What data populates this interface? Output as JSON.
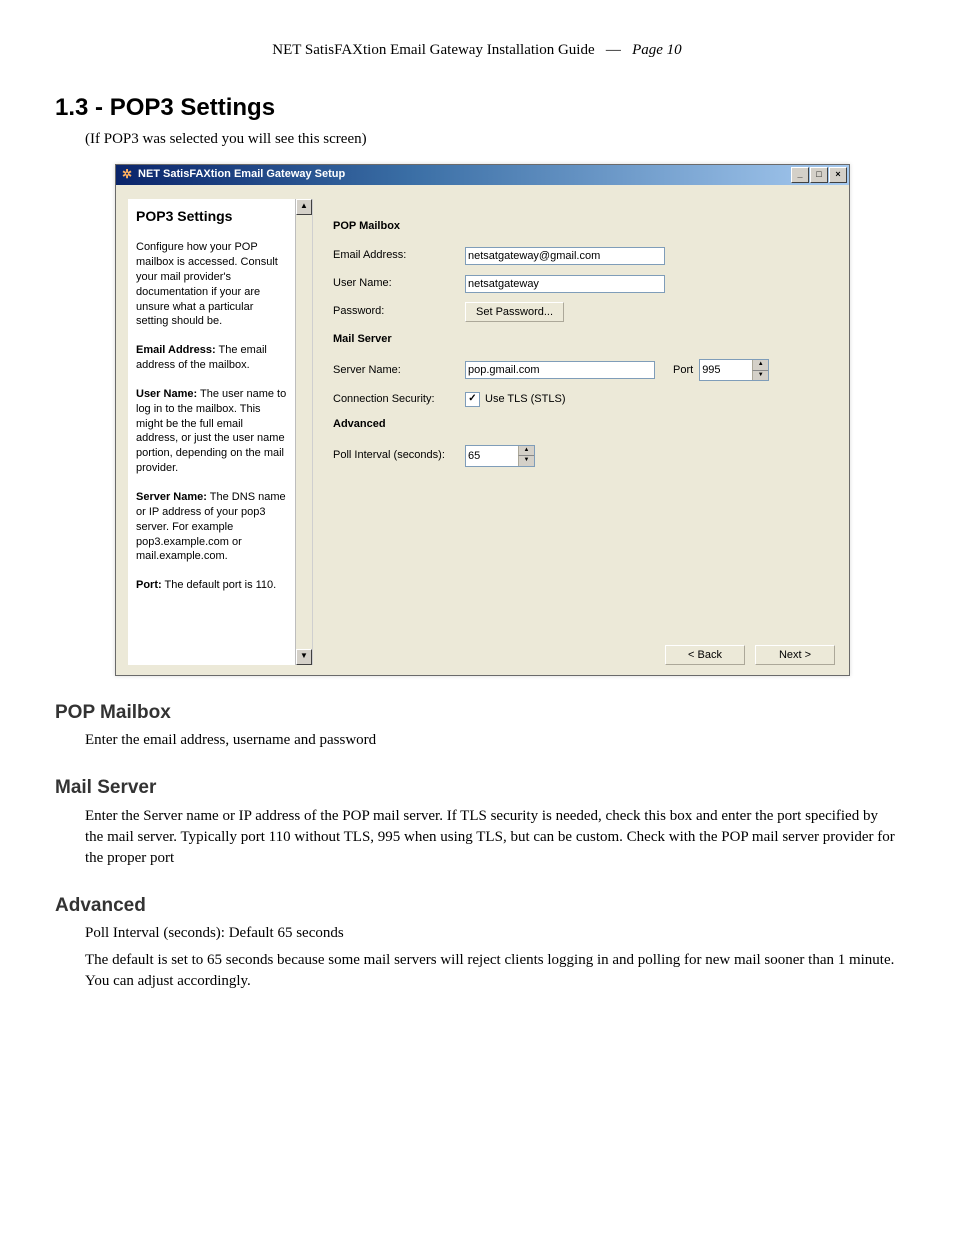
{
  "header": {
    "doc_title": "NET SatisFAXtion Email Gateway Installation Guide",
    "sep": "—",
    "page": "Page 10"
  },
  "section": {
    "title": "1.3 - POP3 Settings",
    "note": "(If POP3 was selected you will see this screen)"
  },
  "window": {
    "title": "NET SatisFAXtion Email Gateway Setup",
    "icon_glyph": "✲"
  },
  "side": {
    "heading": "POP3 Settings",
    "p1": "Configure how your POP mailbox is accessed. Consult your mail provider's documentation if your are unsure what a particular setting should be.",
    "email_b": "Email Address:",
    "email_t": " The email address of the mailbox.",
    "user_b": "User Name:",
    "user_t": " The user name to log in to the mailbox. This might be the full email address, or just the user name portion, depending on the mail provider.",
    "server_b": "Server Name:",
    "server_t": " The DNS name or IP address of your pop3 server. For example pop3.example.com or mail.example.com.",
    "port_b": "Port:",
    "port_t": " The default port is 110."
  },
  "form": {
    "grp_mailbox": "POP Mailbox",
    "email_lbl": "Email Address:",
    "email_val": "netsatgateway@gmail.com",
    "user_lbl": "User Name:",
    "user_val": "netsatgateway",
    "pass_lbl": "Password:",
    "pass_btn": "Set Password...",
    "grp_server": "Mail Server",
    "server_lbl": "Server Name:",
    "server_val": "pop.gmail.com",
    "port_lbl": "Port",
    "port_val": "995",
    "conn_lbl": "Connection Security:",
    "tls_lbl": "Use TLS (STLS)",
    "tls_checked": "✓",
    "grp_adv": "Advanced",
    "poll_lbl": "Poll Interval (seconds):",
    "poll_val": "65",
    "back_btn": "< Back",
    "next_btn": "Next >"
  },
  "body": {
    "h_pop": "POP Mailbox",
    "p_pop": "Enter the email address, username and password",
    "h_ms": "Mail Server",
    "p_ms": "Enter the Server name or IP address of the POP mail server.  If TLS security is needed, check this box and enter the port specified by the mail server.  Typically port 110 without TLS, 995 when using TLS, but can be custom.  Check with the POP mail server provider for the proper port",
    "h_adv": "Advanced",
    "p_adv1": "Poll Interval (seconds): Default 65 seconds",
    "p_adv2": "The default is set to 65 seconds because some mail servers will reject clients logging in and polling for new mail sooner than 1 minute.  You can adjust accordingly."
  }
}
